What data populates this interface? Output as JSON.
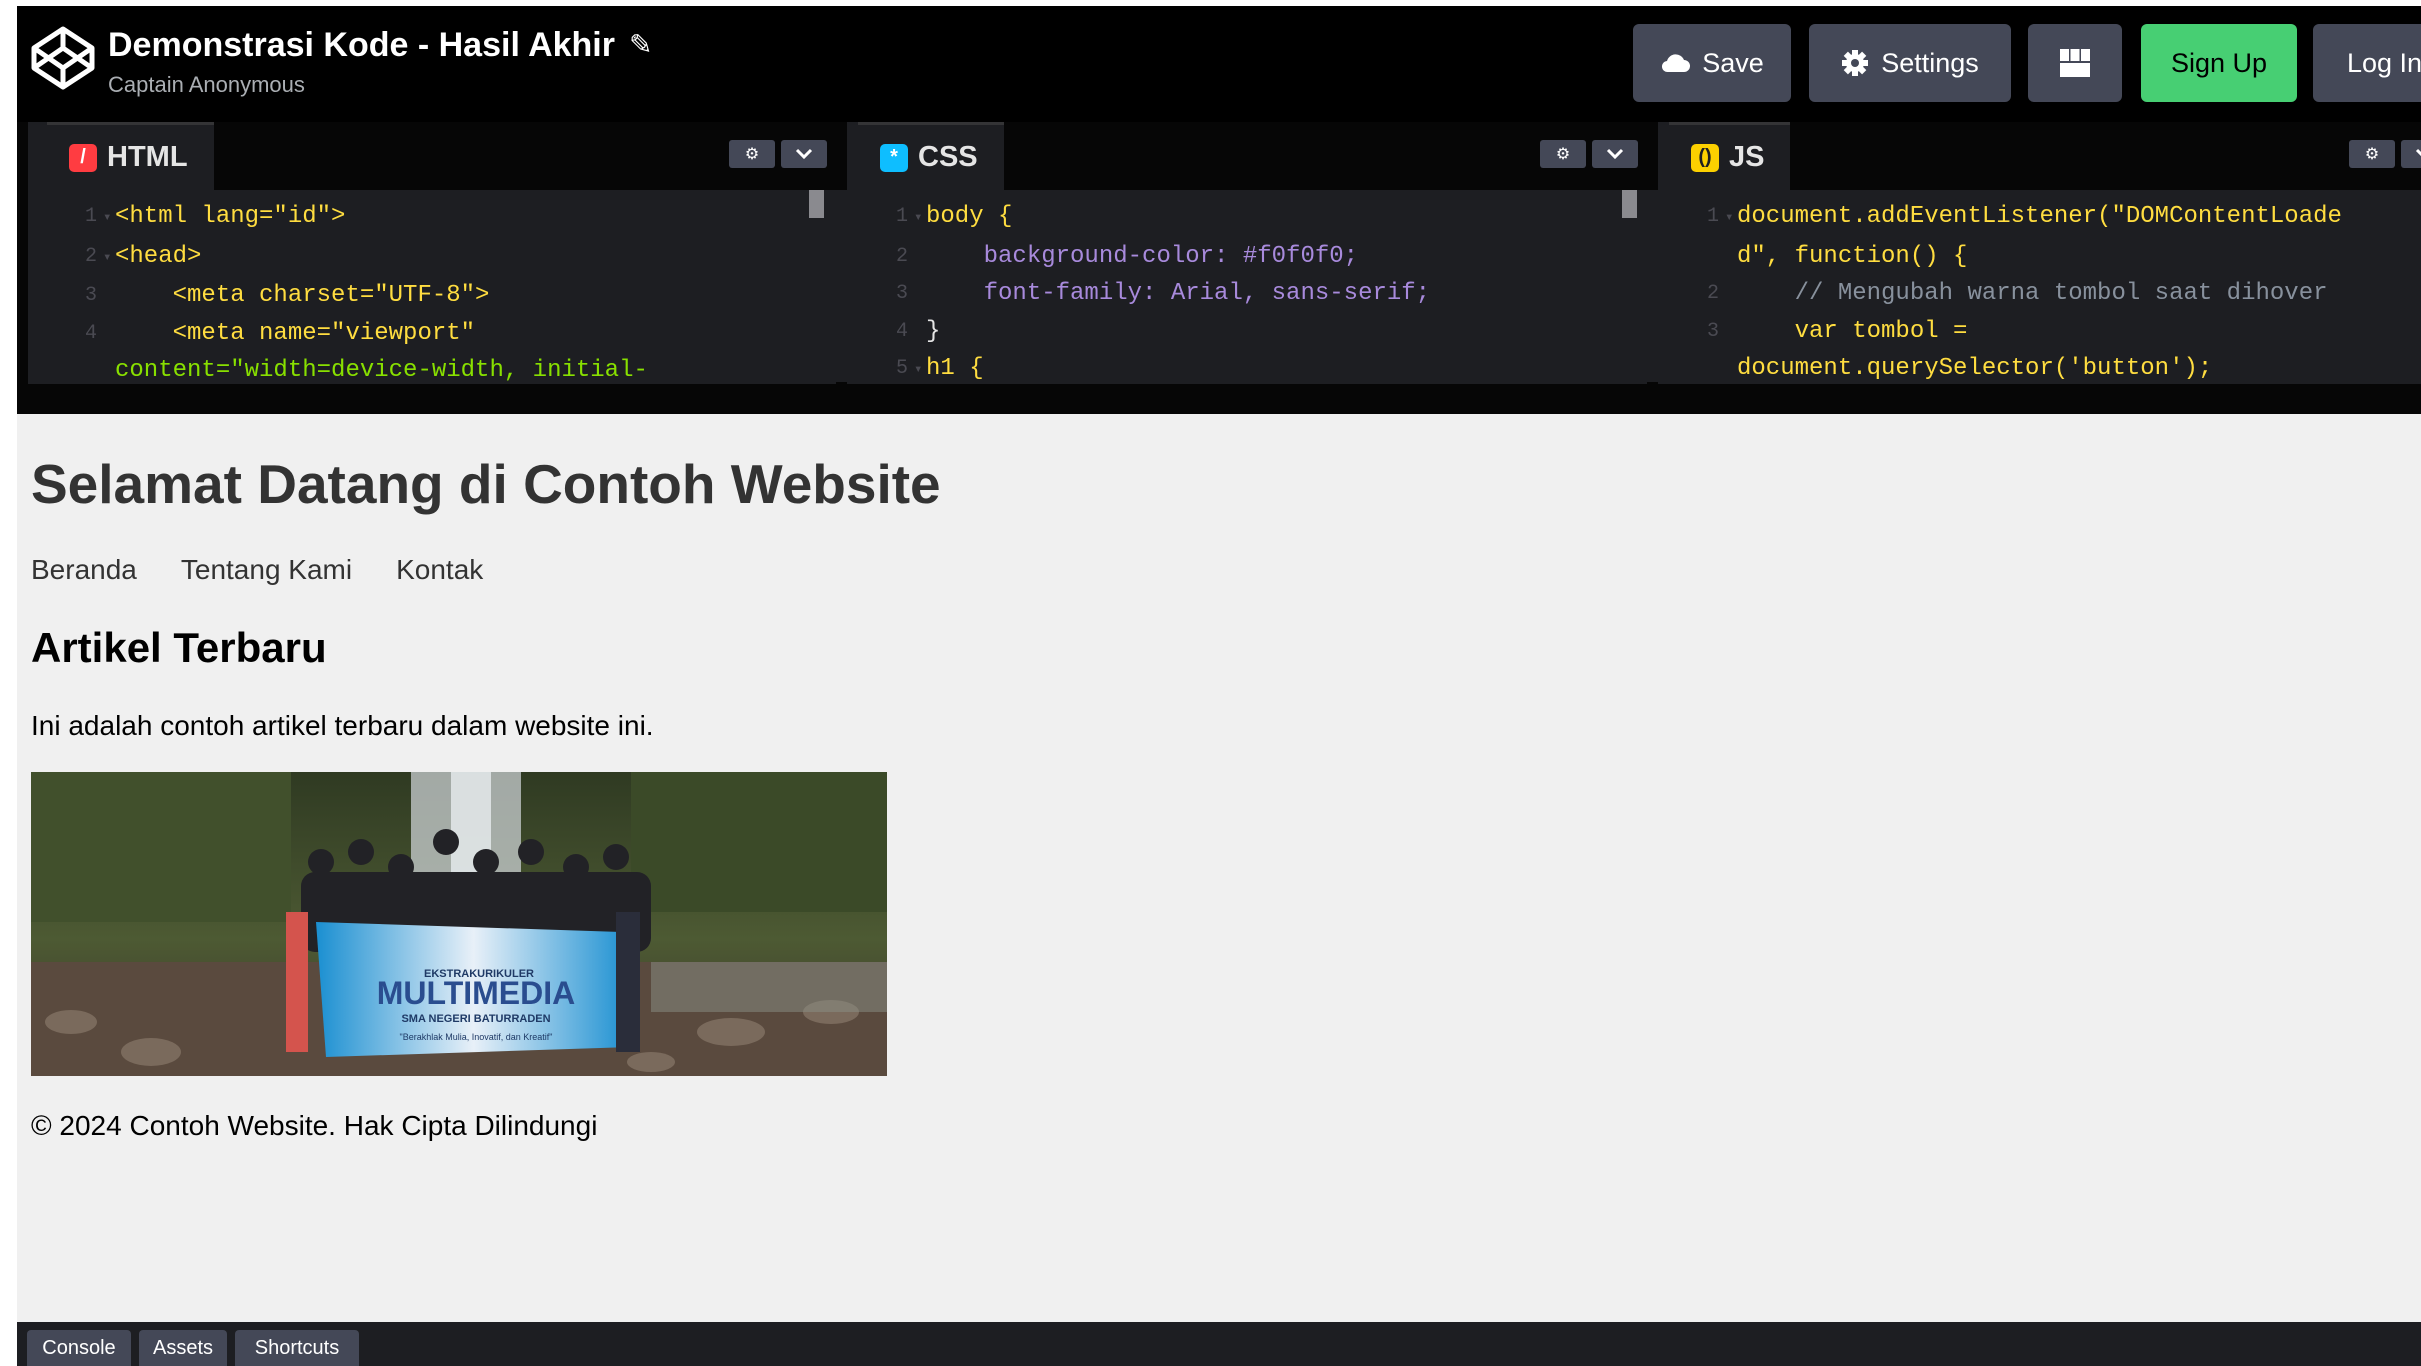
{
  "header": {
    "title": "Demonstrasi Kode - Hasil Akhir",
    "author": "Captain Anonymous",
    "buttons": {
      "save": "Save",
      "settings": "Settings",
      "signup": "Sign Up",
      "login": "Log In"
    },
    "colors": {
      "signup": "#47cf73",
      "button": "#444857"
    }
  },
  "editors": {
    "html": {
      "label": "HTML",
      "line_numbers": [
        "1",
        "2",
        "3",
        "4",
        ""
      ],
      "lines": [
        "<html lang=\"id\">",
        "<head>",
        "    <meta charset=\"UTF-8\">",
        "    <meta name=\"viewport\"",
        "content=\"width=device-width, initial-"
      ]
    },
    "css": {
      "label": "CSS",
      "line_numbers": [
        "1",
        "2",
        "3",
        "4",
        "5"
      ],
      "lines": [
        "body {",
        "    background-color: #f0f0f0;",
        "    font-family: Arial, sans-serif;",
        "}",
        "h1 {"
      ]
    },
    "js": {
      "label": "JS",
      "line_numbers": [
        "1",
        "",
        "2",
        "3",
        ""
      ],
      "lines": [
        "document.addEventListener(\"DOMContentLoade",
        "d\", function() {",
        "    // Mengubah warna tombol saat dihover",
        "    var tombol =",
        "document.querySelector('button');"
      ]
    }
  },
  "preview": {
    "heading": "Selamat Datang di Contoh Website",
    "nav": [
      "Beranda",
      "Tentang Kami",
      "Kontak"
    ],
    "subheading": "Artikel Terbaru",
    "paragraph": "Ini adalah contoh artikel terbaru dalam website ini.",
    "banner_text": "MULTIMEDIA",
    "banner_small": "EKSTRAKURIKULER",
    "banner_school": "SMA NEGERI BATURRADEN",
    "banner_motto": "\"Berakhlak Mulia, Inovatif, dan Kreatif\"",
    "footer": "© 2024 Contoh Website. Hak Cipta Dilindungi"
  },
  "bottombar": {
    "console": "Console",
    "assets": "Assets",
    "shortcuts": "Shortcuts"
  }
}
